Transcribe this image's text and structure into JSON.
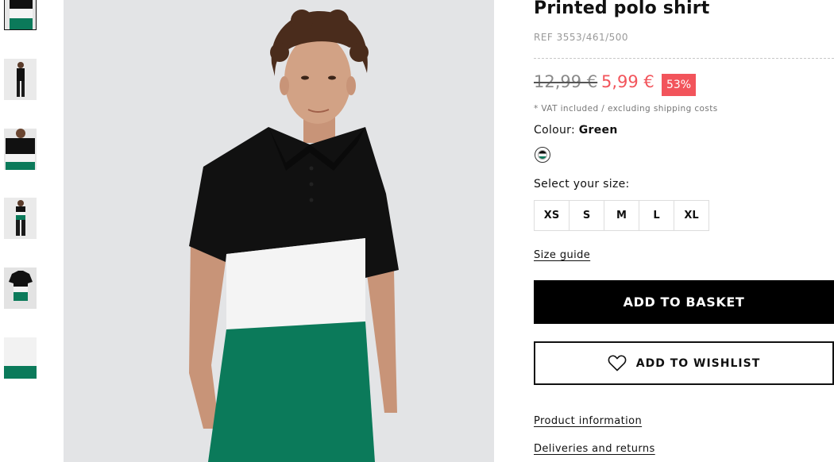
{
  "product": {
    "title": "Printed polo shirt",
    "ref": "REF 3553/461/500",
    "price_old": "12,99 €",
    "price_new": "5,99 €",
    "discount": "53%",
    "vat_note": "* VAT included / excluding shipping costs",
    "colour_label": "Colour:",
    "colour_value": "Green",
    "size_label": "Select your size:",
    "sizes": [
      "XS",
      "S",
      "M",
      "L",
      "XL"
    ],
    "size_guide": "Size guide",
    "add_to_basket": "ADD TO BASKET",
    "add_to_wishlist": "ADD TO WISHLIST",
    "product_information": "Product information",
    "deliveries_returns": "Deliveries and returns"
  },
  "colors": {
    "sale_red": "#f2545b",
    "polo_black": "#111111",
    "polo_white": "#f4f4f4",
    "polo_green": "#0b7a5a"
  },
  "icons": {
    "wishlist": "heart-outline-icon",
    "colour_swatch": "polo-stripe-swatch"
  }
}
